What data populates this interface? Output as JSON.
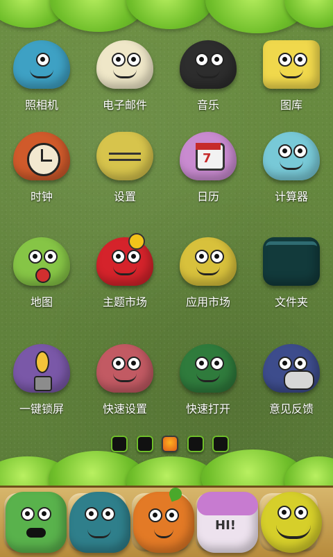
{
  "home": {
    "apps": [
      {
        "label": "照相机",
        "color": "#3ea1c4"
      },
      {
        "label": "电子邮件",
        "color": "#efe7c8"
      },
      {
        "label": "音乐",
        "color": "#2d2d2d"
      },
      {
        "label": "图库",
        "color": "#f0d84c"
      },
      {
        "label": "时钟",
        "color": "#d05a2b"
      },
      {
        "label": "设置",
        "color": "#d7c44c"
      },
      {
        "label": "日历",
        "color": "#c98bd0"
      },
      {
        "label": "计算器",
        "color": "#78c9d7"
      },
      {
        "label": "地图",
        "color": "#86c546"
      },
      {
        "label": "主题市场",
        "color": "#d5232b"
      },
      {
        "label": "应用市场",
        "color": "#d8c13c"
      },
      {
        "label": "文件夹",
        "color": "#123a3b"
      },
      {
        "label": "一键锁屏",
        "color": "#7a58a8"
      },
      {
        "label": "快速设置",
        "color": "#c25a63"
      },
      {
        "label": "快速打开",
        "color": "#2f7b3c"
      },
      {
        "label": "意见反馈",
        "color": "#3d4c8c"
      }
    ],
    "dock": [
      {
        "name": "phone",
        "color": "#59b24c"
      },
      {
        "name": "contacts",
        "color": "#2f7f8b"
      },
      {
        "name": "messages",
        "color": "#e37a26"
      },
      {
        "name": "browser",
        "color": "#ede2ee",
        "text": "HI!"
      },
      {
        "name": "apps",
        "color": "#d6cf2a"
      }
    ]
  }
}
